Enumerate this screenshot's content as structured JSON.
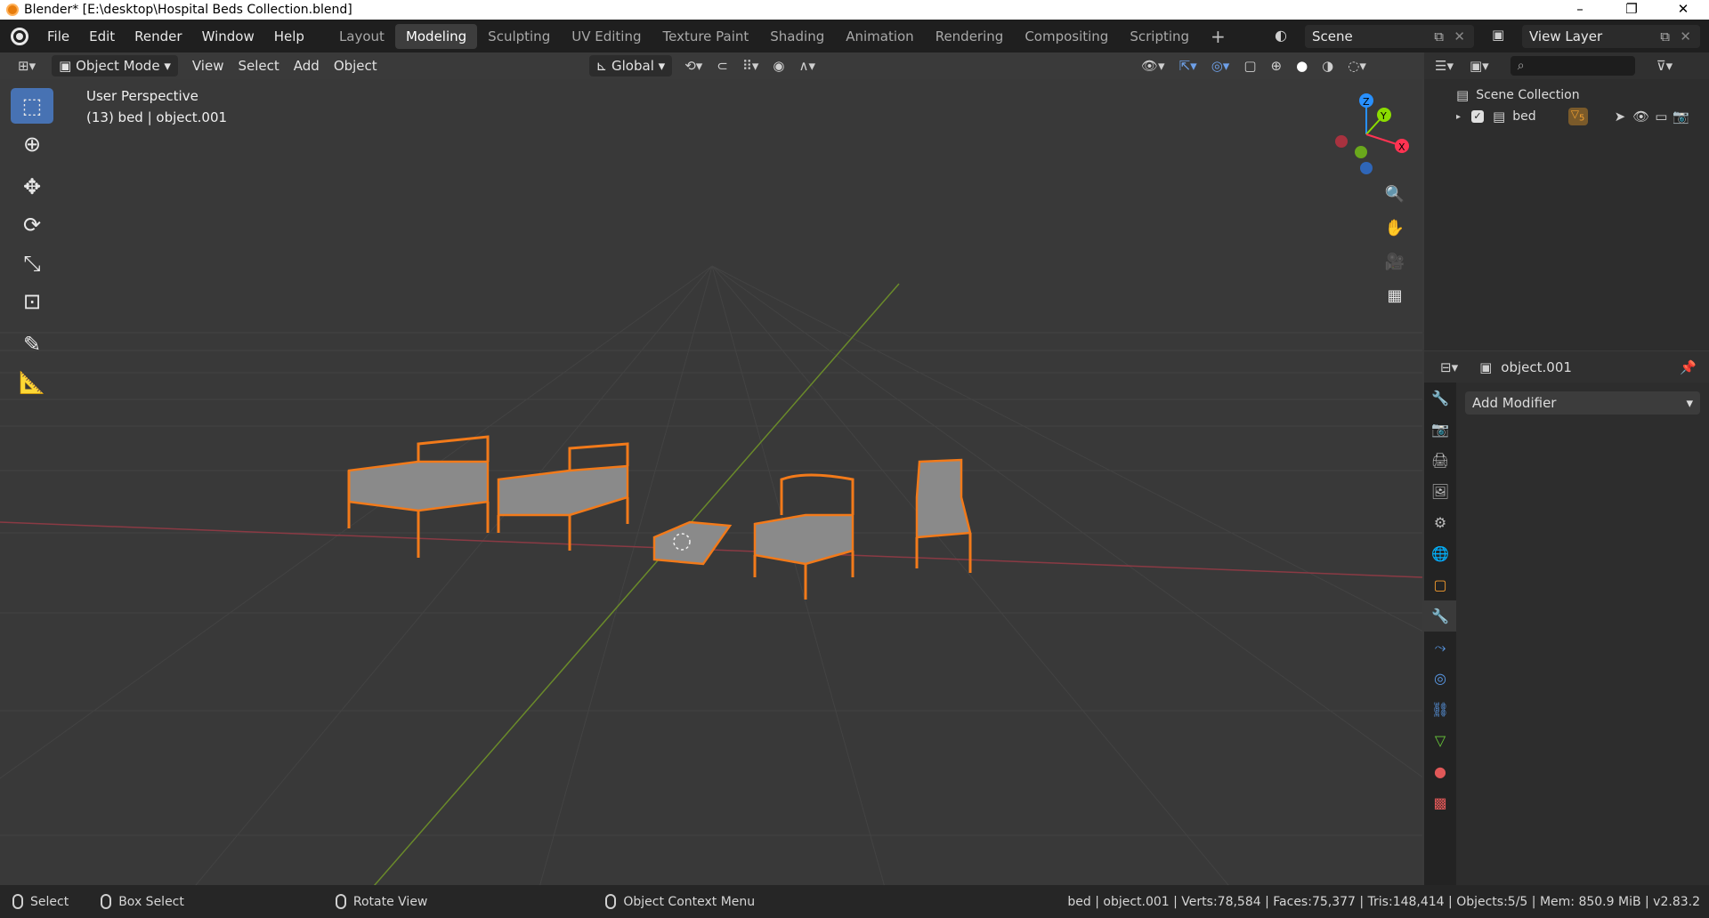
{
  "window": {
    "title": "Blender* [E:\\desktop\\Hospital Beds Collection.blend]",
    "controls": [
      "–",
      "❐",
      "✕"
    ]
  },
  "menu": [
    "File",
    "Edit",
    "Render",
    "Window",
    "Help"
  ],
  "workspaces": [
    "Layout",
    "Modeling",
    "Sculpting",
    "UV Editing",
    "Texture Paint",
    "Shading",
    "Animation",
    "Rendering",
    "Compositing",
    "Scripting"
  ],
  "active_workspace": "Modeling",
  "scene": {
    "name": "Scene",
    "view_layer": "View Layer"
  },
  "header": {
    "mode": "Object Mode",
    "menus": [
      "View",
      "Select",
      "Add",
      "Object"
    ],
    "transform_orientation": "Global"
  },
  "viewport": {
    "view_name": "User Perspective",
    "active_info": "(13) bed | object.001",
    "gizmo_axes": {
      "z": "Z",
      "y": "Y",
      "x": "X"
    }
  },
  "outliner": {
    "root": "Scene Collection",
    "items": [
      {
        "name": "bed",
        "badge": "5"
      }
    ],
    "search_placeholder": ""
  },
  "properties": {
    "object_name": "object.001",
    "add_modifier_label": "Add Modifier"
  },
  "status": {
    "hints": [
      "Select",
      "Box Select",
      "Rotate View",
      "Object Context Menu"
    ],
    "stats": "bed | object.001 | Verts:78,584 | Faces:75,377 | Tris:148,414 | Objects:5/5 | Mem: 850.9 MiB | v2.83.2"
  },
  "colors": {
    "accent_blue": "#4772b3",
    "selection_orange": "#f27a1a",
    "axis_x": "#ff3352",
    "axis_y": "#8bdc00",
    "axis_z": "#2890ff"
  }
}
